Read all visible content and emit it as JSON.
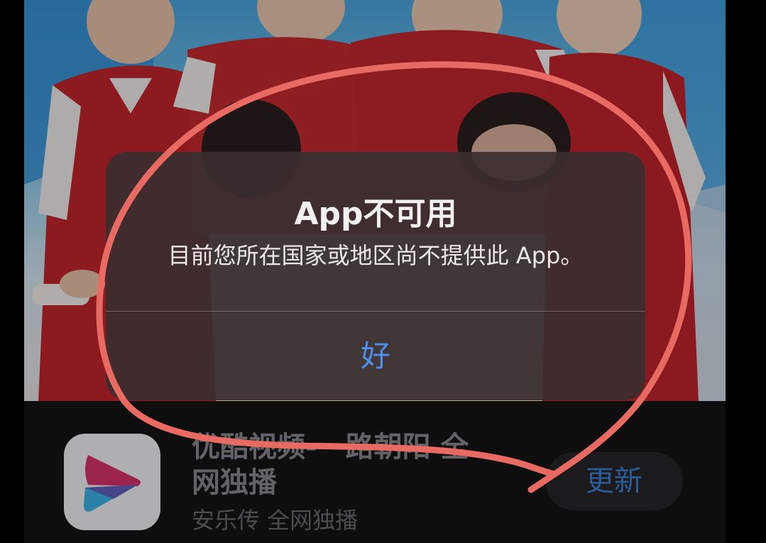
{
  "alert": {
    "title": "App不可用",
    "message": "目前您所在国家或地区尚不提供此 App。",
    "button_label": "好"
  },
  "app_listing": {
    "title_line1": "优酷视频-一路朝阳 全",
    "title_line2": "网独播",
    "subtitle": "安乐传 全网独播",
    "update_button_label": "更新",
    "icon": "youku-play-icon"
  },
  "banner": {
    "description_icon": "promotional-artwork"
  },
  "colors": {
    "alert_background": "#3a2e2e",
    "alert_button": "#4d8ff0",
    "update_button_text": "#3d7fd6",
    "annotation_stroke": "#e86a62"
  }
}
